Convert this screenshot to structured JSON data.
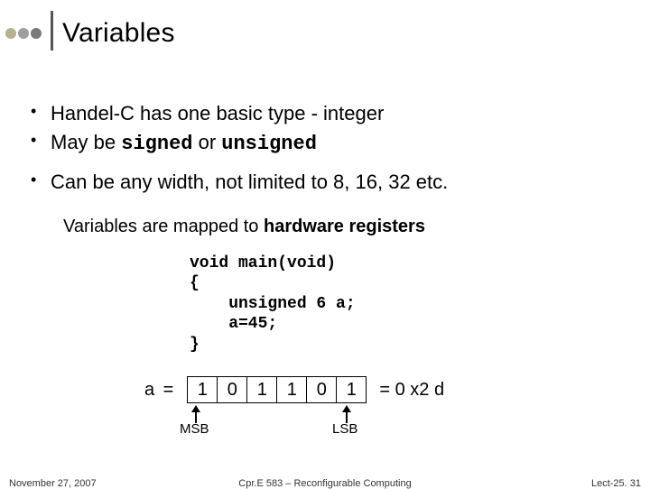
{
  "title": "Variables",
  "bullets": {
    "b1": "Handel-C has one basic type - integer",
    "b2_pre": "May be ",
    "b2_kw1": "signed",
    "b2_mid": " or ",
    "b2_kw2": "unsigned",
    "b3": "Can be any width, not limited to 8, 16, 32 etc."
  },
  "mapline": {
    "pre": "Variables are mapped to ",
    "bold": "hardware registers"
  },
  "code": {
    "l1": "void main(void)",
    "l2": "{",
    "l3": "    unsigned 6 a;",
    "l4": "    a=45;",
    "l5": "}"
  },
  "bits": {
    "label": "a =",
    "cells": [
      "1",
      "0",
      "1",
      "1",
      "0",
      "1"
    ],
    "hex": "= 0 x2 d",
    "msb": "MSB",
    "lsb": "LSB"
  },
  "footer": {
    "left": "November 27, 2007",
    "center": "Cpr.E 583 – Reconfigurable Computing",
    "right": "Lect-25. 31"
  }
}
